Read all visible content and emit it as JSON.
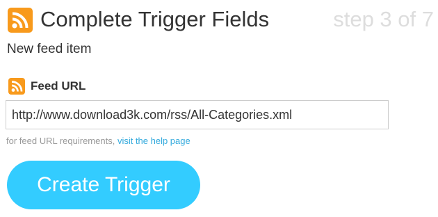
{
  "header": {
    "title": "Complete Trigger Fields",
    "step_text": "step 3 of 7",
    "icon": "rss-icon"
  },
  "trigger": {
    "name": "New feed item"
  },
  "field": {
    "label": "Feed URL",
    "icon": "rss-icon",
    "value": "http://www.download3k.com/rss/All-Categories.xml",
    "help_prefix": "for feed URL requirements,",
    "help_link": "visit the help page"
  },
  "actions": {
    "create_label": "Create Trigger"
  },
  "colors": {
    "rss_orange": "#f89a1c",
    "button_blue": "#33ccff",
    "link_blue": "#33aadd",
    "step_gray": "#dddddd"
  }
}
